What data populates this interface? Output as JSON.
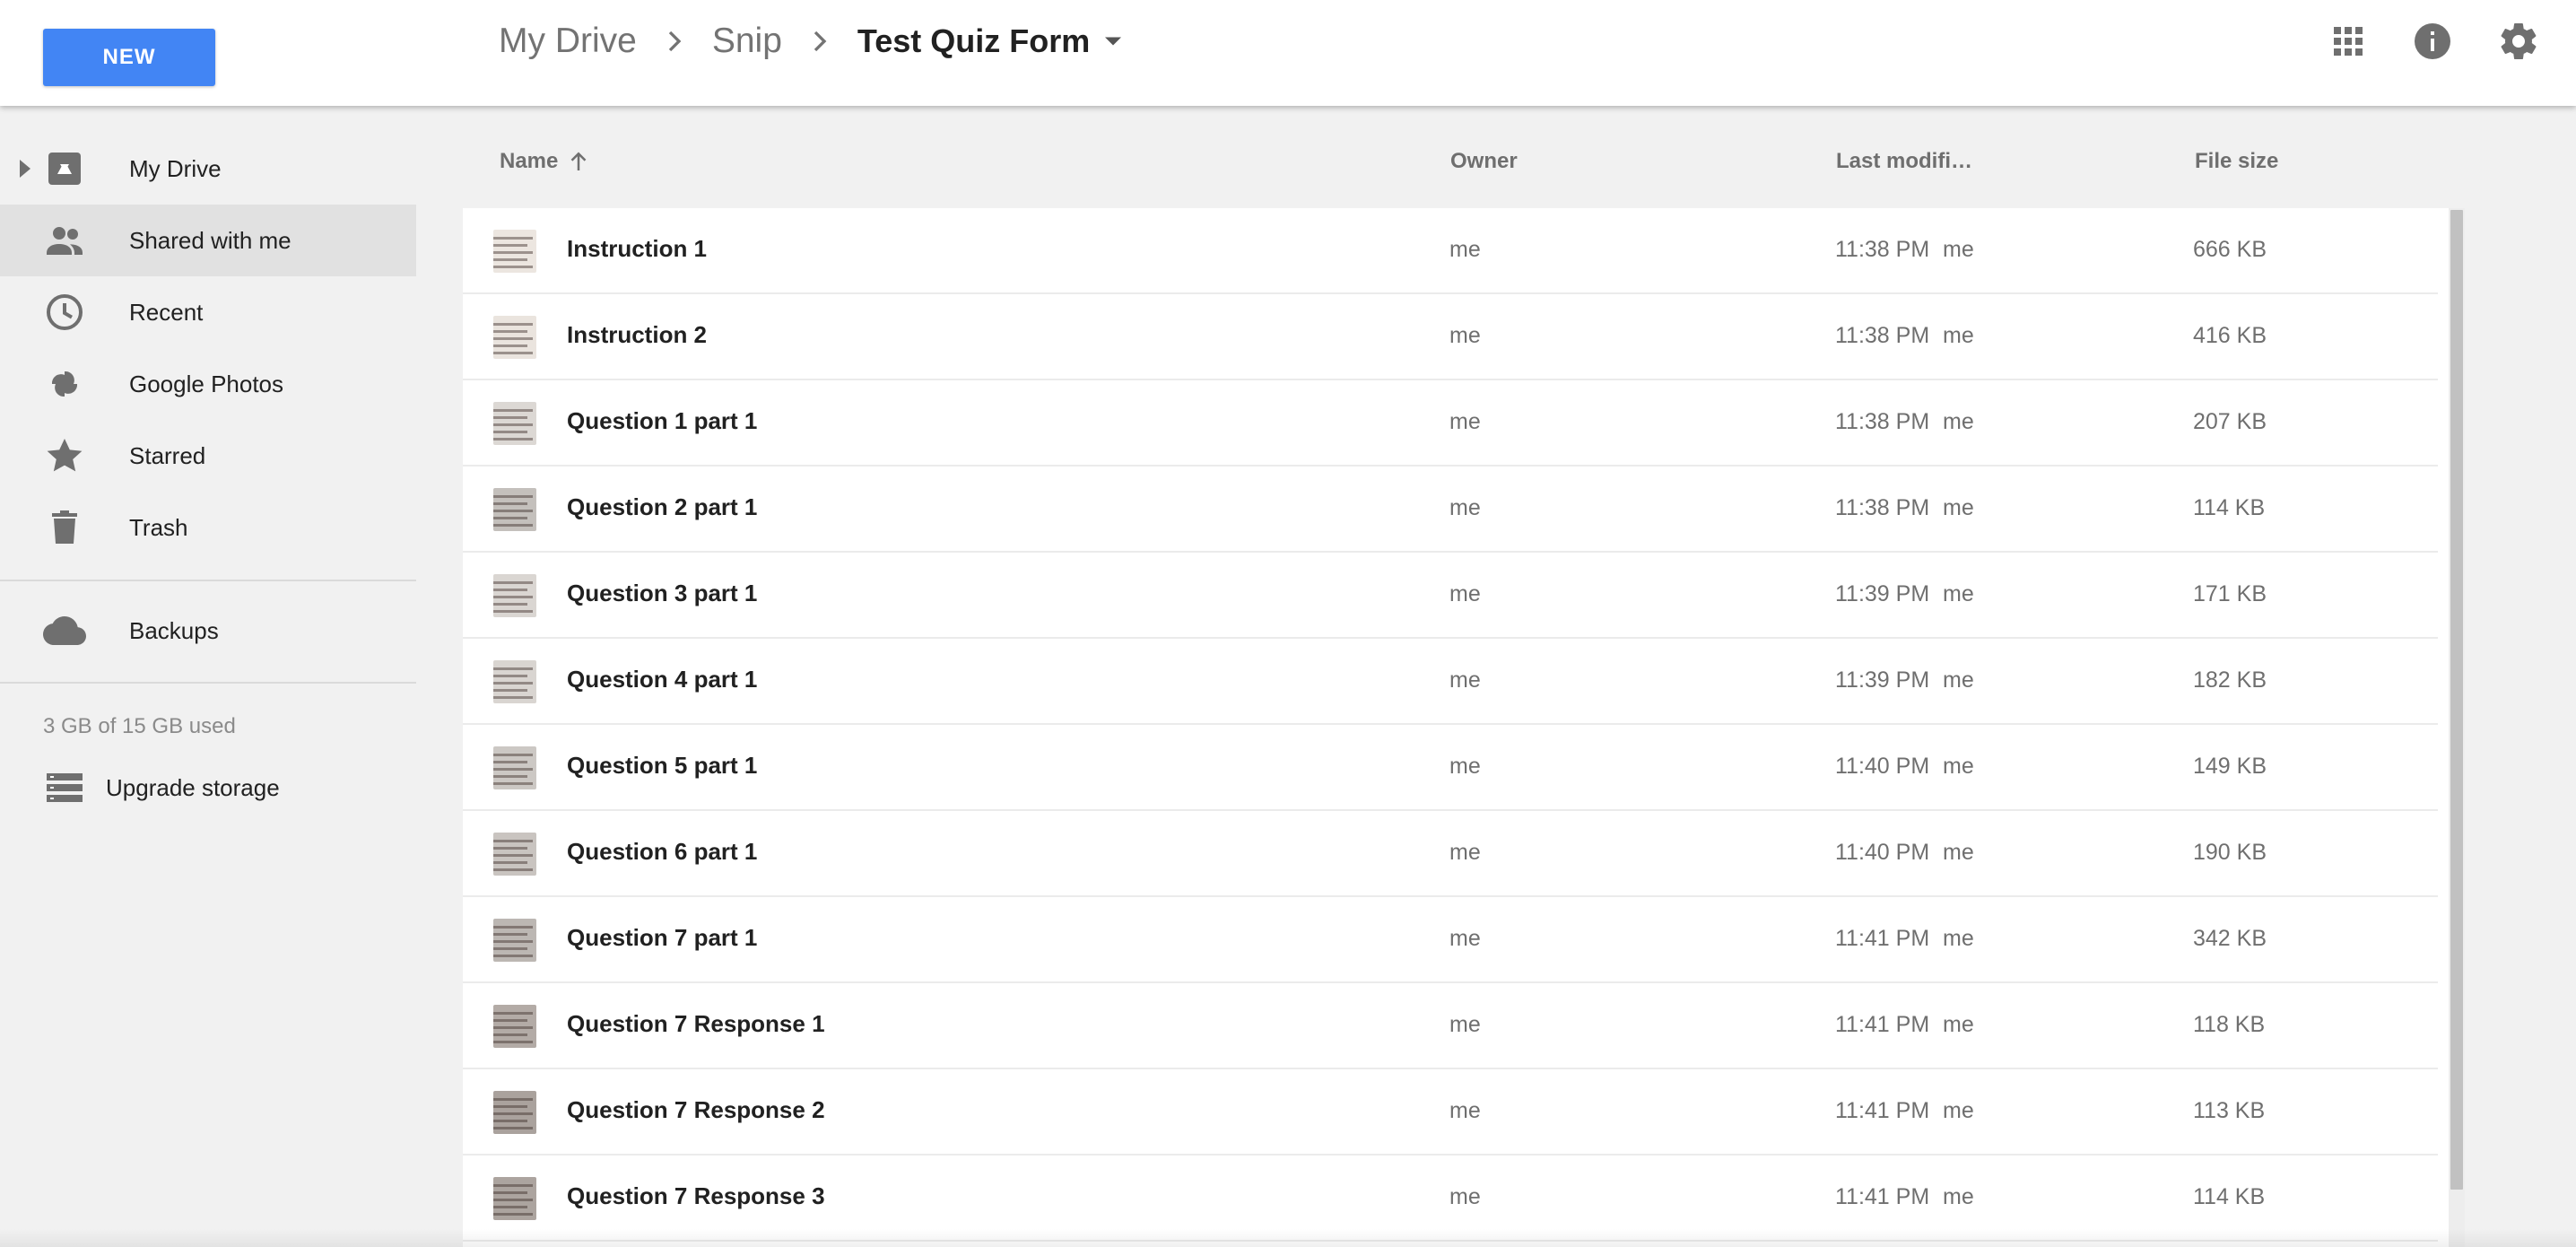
{
  "header": {
    "new_label": "NEW",
    "breadcrumb": [
      "My Drive",
      "Snip"
    ],
    "current_folder": "Test Quiz Form",
    "icons": [
      "apps-grid-icon",
      "info-icon",
      "settings-gear-icon"
    ]
  },
  "sidebar": {
    "items": [
      {
        "label": "My Drive",
        "icon": "drive-icon"
      },
      {
        "label": "Shared with me",
        "icon": "people-icon",
        "active": true
      },
      {
        "label": "Recent",
        "icon": "clock-icon"
      },
      {
        "label": "Google Photos",
        "icon": "pinwheel-icon"
      },
      {
        "label": "Starred",
        "icon": "star-icon"
      },
      {
        "label": "Trash",
        "icon": "trash-icon"
      }
    ],
    "backups": {
      "label": "Backups",
      "icon": "cloud-icon"
    },
    "storage_text": "3 GB of 15 GB used",
    "upgrade": {
      "label": "Upgrade storage",
      "icon": "storage-icon"
    }
  },
  "columns": {
    "name": "Name",
    "owner": "Owner",
    "last_modified": "Last modifi…",
    "file_size": "File size"
  },
  "files": [
    {
      "name": "Instruction 1",
      "owner": "me",
      "modified": "11:38 PM",
      "modified_by": "me",
      "size": "666 KB",
      "thumb": "#ece6e0"
    },
    {
      "name": "Instruction 2",
      "owner": "me",
      "modified": "11:38 PM",
      "modified_by": "me",
      "size": "416 KB",
      "thumb": "#eae4de"
    },
    {
      "name": "Question 1 part 1",
      "owner": "me",
      "modified": "11:38 PM",
      "modified_by": "me",
      "size": "207 KB",
      "thumb": "#dcd8d4"
    },
    {
      "name": "Question 2 part 1",
      "owner": "me",
      "modified": "11:38 PM",
      "modified_by": "me",
      "size": "114 KB",
      "thumb": "#c4c0bc"
    },
    {
      "name": "Question 3 part 1",
      "owner": "me",
      "modified": "11:39 PM",
      "modified_by": "me",
      "size": "171 KB",
      "thumb": "#dad6d2"
    },
    {
      "name": "Question 4 part 1",
      "owner": "me",
      "modified": "11:39 PM",
      "modified_by": "me",
      "size": "182 KB",
      "thumb": "#d9d5d1"
    },
    {
      "name": "Question 5 part 1",
      "owner": "me",
      "modified": "11:40 PM",
      "modified_by": "me",
      "size": "149 KB",
      "thumb": "#ccc8c4"
    },
    {
      "name": "Question 6 part 1",
      "owner": "me",
      "modified": "11:40 PM",
      "modified_by": "me",
      "size": "190 KB",
      "thumb": "#c9c4c0"
    },
    {
      "name": "Question 7 part 1",
      "owner": "me",
      "modified": "11:41 PM",
      "modified_by": "me",
      "size": "342 KB",
      "thumb": "#bcb7b3"
    },
    {
      "name": "Question 7 Response 1",
      "owner": "me",
      "modified": "11:41 PM",
      "modified_by": "me",
      "size": "118 KB",
      "thumb": "#b3aba6"
    },
    {
      "name": "Question 7 Response 2",
      "owner": "me",
      "modified": "11:41 PM",
      "modified_by": "me",
      "size": "113 KB",
      "thumb": "#aaa29d"
    },
    {
      "name": "Question 7 Response 3",
      "owner": "me",
      "modified": "11:41 PM",
      "modified_by": "me",
      "size": "114 KB",
      "thumb": "#aca49f"
    }
  ],
  "colors": {
    "accent": "#4285f4",
    "active_nav_bg": "#e1e1e1",
    "icon_gray": "#737373"
  }
}
